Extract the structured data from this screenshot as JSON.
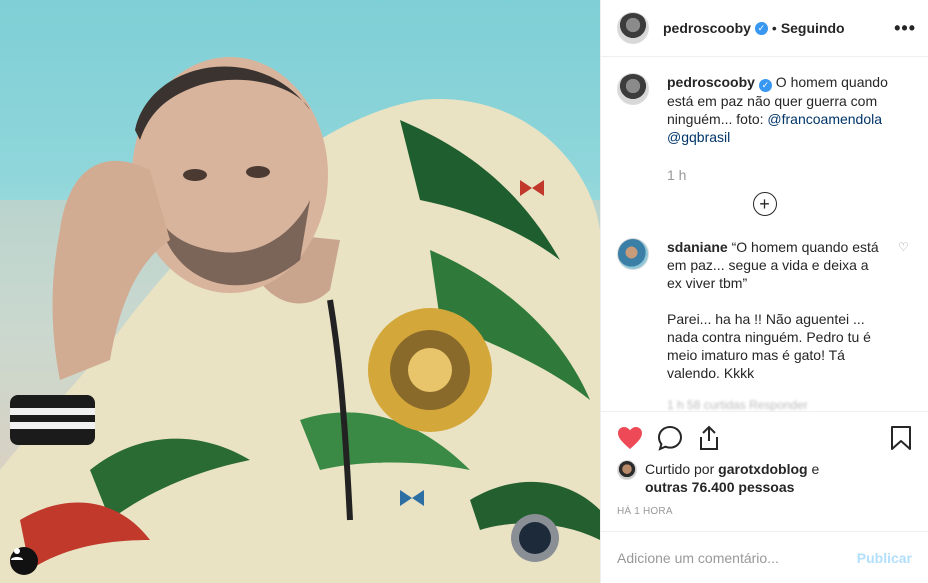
{
  "post": {
    "username": "pedroscooby",
    "verified_glyph": "✓",
    "separator": "•",
    "follow_status": "Seguindo",
    "more_glyph": "•••"
  },
  "caption": {
    "username": "pedroscooby",
    "text": "O homem quando está em paz não quer guerra com ninguém... foto: ",
    "mention1": "@francoamendola",
    "mention2": "@gqbrasil",
    "time": "1 h"
  },
  "load_more_glyph": "+",
  "comment": {
    "username": "sdaniane",
    "text1": "“O homem quando está em paz... segue a vida e deixa a ex viver tbm”",
    "text2": "Parei... ha ha !! Não aguentei ... nada contra ninguém. Pedro tu é meio imaturo mas é gato! Tá valendo. Kkkk",
    "meta_faded": "1 h   58 curtidas   Responder",
    "heart_glyph": "♡"
  },
  "likes": {
    "prefix": "Curtido por ",
    "user": "garotxdoblog",
    "middle": " e",
    "others": "outras 76.400 pessoas"
  },
  "time_ago": "HÁ 1 HORA",
  "add_comment": {
    "placeholder": "Adicione um comentário...",
    "publish": "Publicar"
  },
  "colors": {
    "like_red": "#ed4956",
    "link_blue": "#003569",
    "verified_blue": "#3897f0",
    "publish_disabled": "#b2dffc"
  }
}
